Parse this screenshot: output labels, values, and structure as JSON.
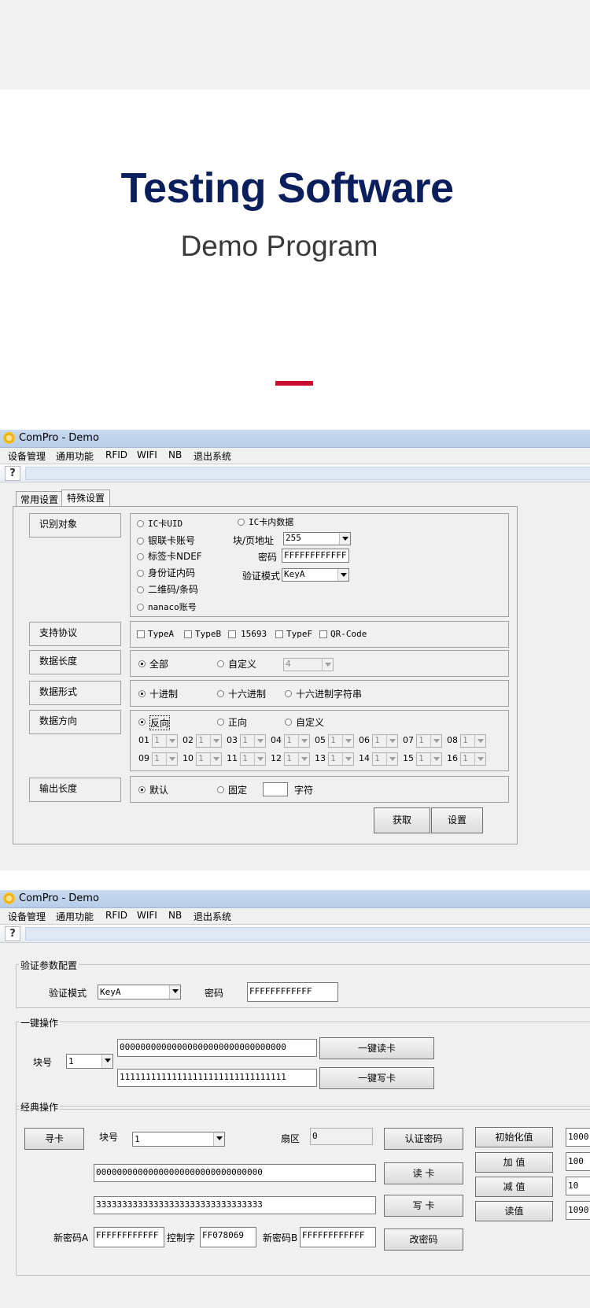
{
  "hero": {
    "title": "Testing Software",
    "subtitle": "Demo Program"
  },
  "accent_colors": {
    "title": "#0b1f5c",
    "bar": "#c8102e"
  },
  "window1": {
    "title": "ComPro - Demo",
    "menu": [
      "设备管理",
      "通用功能",
      "RFID",
      "WIFI",
      "NB",
      "退出系统"
    ],
    "toolbar_icon": "help-icon",
    "tabs": [
      "常用设置",
      "特殊设置"
    ],
    "labels": {
      "identify": "识别对象",
      "protocol": "支持协议",
      "length": "数据长度",
      "format": "数据形式",
      "direction": "数据方向",
      "output": "输出长度"
    },
    "identify": {
      "left_options": [
        "IC卡UID",
        "银联卡账号",
        "标签卡NDEF",
        "身份证内码",
        "二维码/条码",
        "nanaco账号"
      ],
      "ic_data": "IC卡内数据",
      "block_label": "块/页地址",
      "block_value": "255",
      "password_label": "密码",
      "password_value": "FFFFFFFFFFFF",
      "auth_label": "验证模式",
      "auth_value": "KeyA"
    },
    "protocols": [
      "TypeA",
      "TypeB",
      "15693",
      "TypeF",
      "QR-Code"
    ],
    "length": {
      "all": "全部",
      "custom": "自定义",
      "custom_value": "4"
    },
    "format": {
      "dec": "十进制",
      "hex": "十六进制",
      "hexstr": "十六进制字符串"
    },
    "direction": {
      "reverse": "反向",
      "forward": "正向",
      "custom": "自定义",
      "slots": [
        "01",
        "02",
        "03",
        "04",
        "05",
        "06",
        "07",
        "08",
        "09",
        "10",
        "11",
        "12",
        "13",
        "14",
        "15",
        "16"
      ],
      "slot_value": "1"
    },
    "output": {
      "default": "默认",
      "fixed": "固定",
      "unit": "字符"
    },
    "buttons": {
      "get": "获取",
      "set": "设置"
    }
  },
  "window2": {
    "title": "ComPro - Demo",
    "menu": [
      "设备管理",
      "通用功能",
      "RFID",
      "WIFI",
      "NB",
      "退出系统"
    ],
    "auth_group": {
      "legend": "验证参数配置",
      "mode_label": "验证模式",
      "mode_value": "KeyA",
      "pwd_label": "密码",
      "pwd_value": "FFFFFFFFFFFF"
    },
    "onekey_group": {
      "legend": "一键操作",
      "block_label": "块号",
      "block_value": "1",
      "read_data": "00000000000000000000000000000000",
      "write_data": "11111111111111111111111111111111",
      "read_btn": "一键读卡",
      "write_btn": "一键写卡"
    },
    "classic_group": {
      "legend": "经典操作",
      "find_btn": "寻卡",
      "block_label": "块号",
      "block_value": "1",
      "sector_label": "扇区",
      "sector_value": "0",
      "auth_btn": "认证密码",
      "read_data": "00000000000000000000000000000000",
      "read_btn": "读 卡",
      "write_data": "33333333333333333333333333333333",
      "write_btn": "写 卡",
      "newA_label": "新密码A",
      "newA_value": "FFFFFFFFFFFF",
      "ctrl_label": "控制字",
      "ctrl_value": "FF078069",
      "newB_label": "新密码B",
      "newB_value": "FFFFFFFFFFFF",
      "change_btn": "改密码",
      "init_btn": "初始化值",
      "init_value": "1000",
      "add_btn": "加 值",
      "add_value": "100",
      "sub_btn": "减 值",
      "sub_value": "10",
      "read_val_btn": "读值",
      "read_val_value": "1090"
    }
  }
}
